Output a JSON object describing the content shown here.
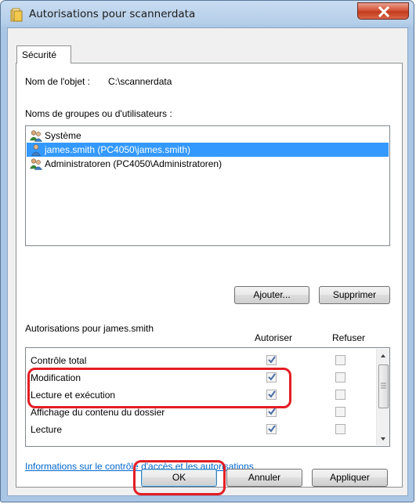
{
  "window": {
    "title": "Autorisations pour scannerdata",
    "close_label": "X"
  },
  "tabs": [
    {
      "label": "Sécurité",
      "selected": true
    }
  ],
  "object": {
    "label": "Nom de l'objet :",
    "value": "C:\\scannerdata"
  },
  "groups": {
    "label": "Noms de groupes ou d'utilisateurs :",
    "items": [
      {
        "label": "Système",
        "icon": "users-group-icon",
        "selected": false
      },
      {
        "label": "james.smith (PC4050\\james.smith)",
        "icon": "user-icon",
        "selected": true
      },
      {
        "label": "Administratoren (PC4050\\Administratoren)",
        "icon": "users-group-icon",
        "selected": false
      }
    ],
    "add_label": "Ajouter...",
    "remove_label": "Supprimer"
  },
  "permissions": {
    "label": "Autorisations pour james.smith",
    "allow_header": "Autoriser",
    "deny_header": "Refuser",
    "rows": [
      {
        "name": "Contrôle total",
        "allow": true,
        "deny": false
      },
      {
        "name": "Modification",
        "allow": true,
        "deny": false
      },
      {
        "name": "Lecture et exécution",
        "allow": true,
        "deny": false
      },
      {
        "name": "Affichage du contenu du dossier",
        "allow": true,
        "deny": false
      },
      {
        "name": "Lecture",
        "allow": true,
        "deny": false
      }
    ]
  },
  "link_text": "Informations sur le contrôle d'accès et les autorisations",
  "footer": {
    "ok_label": "OK",
    "cancel_label": "Annuler",
    "apply_label": "Appliquer"
  },
  "colors": {
    "highlight": "#e31e24",
    "selection": "#3399ff",
    "link": "#0066cc"
  }
}
